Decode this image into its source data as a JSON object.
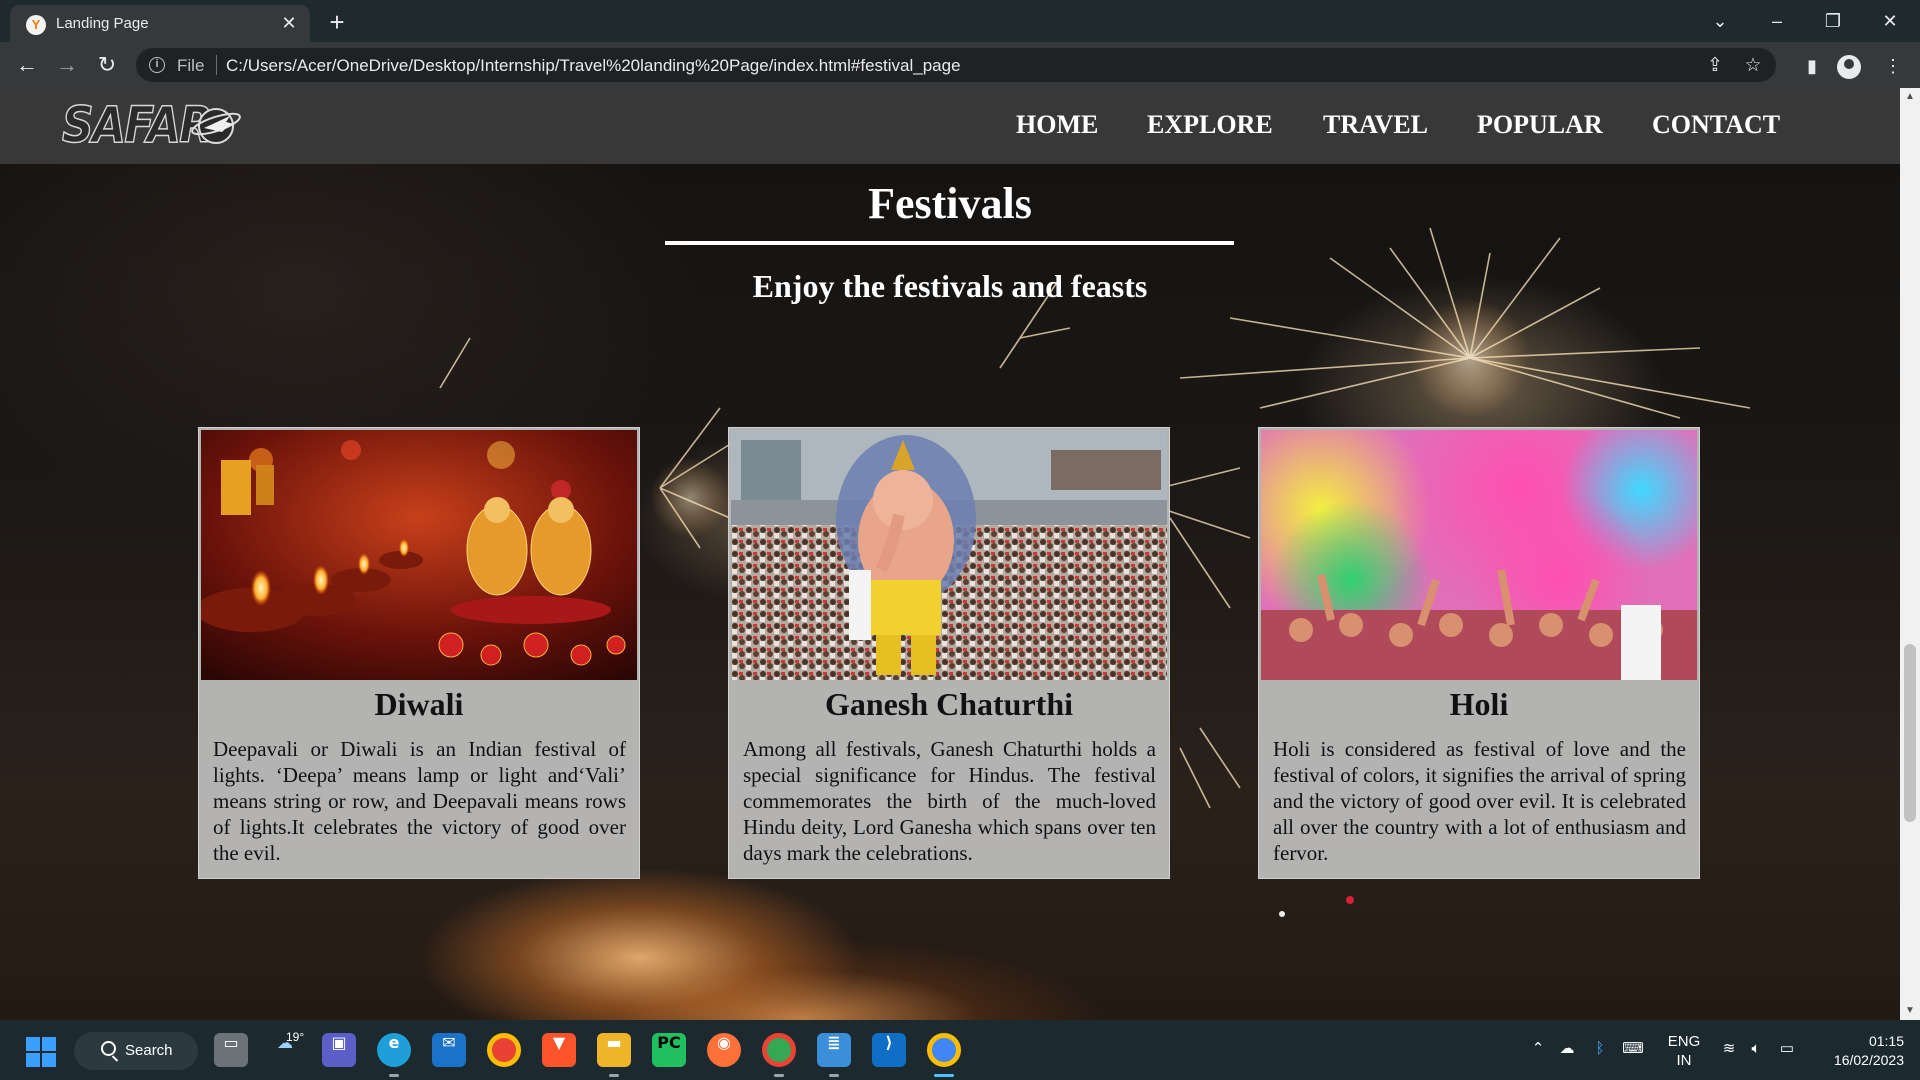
{
  "browser": {
    "tab_title": "Landing Page",
    "favicon_letter": "Y",
    "url_scheme": "File",
    "url": "C:/Users/Acer/OneDrive/Desktop/Internship/Travel%20landing%20Page/index.html#festival_page"
  },
  "site": {
    "logo_text": "SAFAR",
    "nav": [
      "HOME",
      "EXPLORE",
      "TRAVEL",
      "POPULAR",
      "CONTACT"
    ]
  },
  "section": {
    "title": "Festivals",
    "subtitle": "Enjoy the festivals and feasts"
  },
  "cards": [
    {
      "title": "Diwali",
      "text": "Deepavali or Diwali is an Indian festival of lights. ‘Deepa’ means lamp or light and‘Vali’ means string or row, and Deepavali means rows of lights.It celebrates the victory of good over the evil."
    },
    {
      "title": "Ganesh Chaturthi",
      "text": "Among all festivals, Ganesh Chaturthi holds a special significance for Hindus. The festival commemorates the birth of the much-loved Hindu deity, Lord Ganesha which spans over ten days mark the celebrations."
    },
    {
      "title": "Holi",
      "text": "Holi is considered as festival of love and the festival of colors, it signifies the arrival of spring and the victory of good over evil. It is celebrated all over the country with a lot of enthusiasm and fervor."
    }
  ],
  "taskbar": {
    "search_label": "Search",
    "weather_temp": "19°",
    "lang_line1": "ENG",
    "lang_line2": "IN",
    "time": "01:15",
    "date": "16/02/2023"
  },
  "colors": {
    "browser_frame": "#1f2a2f",
    "toolbar": "#35393c",
    "header_bar": "#3c3c3c",
    "card_background": "#bebebe",
    "taskbar": "#1c2a30"
  }
}
